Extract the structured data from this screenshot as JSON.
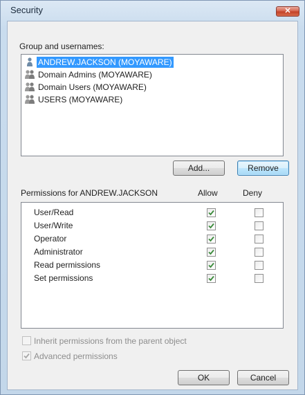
{
  "window": {
    "title": "Security"
  },
  "groups": {
    "label": "Group and usernames:",
    "items": [
      {
        "name": "ANDREW.JACKSON (MOYAWARE)",
        "type": "user",
        "selected": true
      },
      {
        "name": "Domain Admins (MOYAWARE)",
        "type": "group",
        "selected": false
      },
      {
        "name": "Domain Users (MOYAWARE)",
        "type": "group",
        "selected": false
      },
      {
        "name": "USERS (MOYAWARE)",
        "type": "group",
        "selected": false
      }
    ],
    "add_label": "Add...",
    "remove_label": "Remove"
  },
  "permissions": {
    "header_label": "Permissions for ANDREW.JACKSON",
    "allow_label": "Allow",
    "deny_label": "Deny",
    "rows": [
      {
        "name": "User/Read",
        "allow": true,
        "deny": false
      },
      {
        "name": "User/Write",
        "allow": true,
        "deny": false
      },
      {
        "name": "Operator",
        "allow": true,
        "deny": false
      },
      {
        "name": "Administrator",
        "allow": true,
        "deny": false
      },
      {
        "name": "Read permissions",
        "allow": true,
        "deny": false
      },
      {
        "name": "Set permissions",
        "allow": true,
        "deny": false
      }
    ]
  },
  "options": {
    "inherit_label": "Inherit permissions from the parent object",
    "inherit_checked": false,
    "advanced_label": "Advanced permissions",
    "advanced_checked": true
  },
  "footer": {
    "ok_label": "OK",
    "cancel_label": "Cancel"
  },
  "colors": {
    "check": "#3a8a3a",
    "selection": "#3399ff"
  }
}
